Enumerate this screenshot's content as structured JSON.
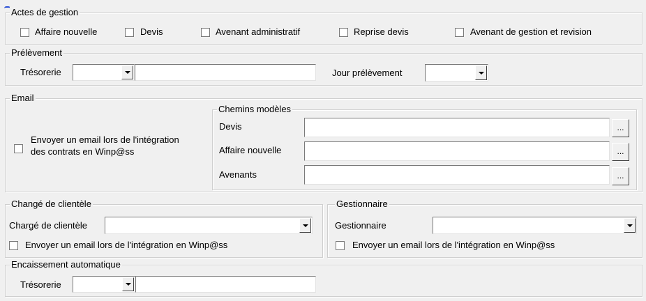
{
  "actes": {
    "legend": "Actes de gestion",
    "items": [
      {
        "label": "Affaire nouvelle"
      },
      {
        "label": "Devis"
      },
      {
        "label": "Avenant administratif"
      },
      {
        "label": "Reprise devis"
      },
      {
        "label": "Avenant de gestion et revision"
      }
    ]
  },
  "prelevement": {
    "legend": "Prélèvement",
    "tresorerie_label": "Trésorerie",
    "jour_label": "Jour prélèvement"
  },
  "email": {
    "legend": "Email",
    "checkbox_line1": "Envoyer un email lors de l'intégration",
    "checkbox_line2": "des contrats en Winp@ss",
    "chemins": {
      "legend": "Chemins modèles",
      "rows": [
        {
          "label": "Devis",
          "button": "..."
        },
        {
          "label": "Affaire nouvelle",
          "button": "..."
        },
        {
          "label": "Avenants",
          "button": "..."
        }
      ]
    }
  },
  "charge": {
    "legend": "Changé de clientèle",
    "label": "Chargé de clientèle",
    "checkbox": "Envoyer un email lors de l'intégration en Winp@ss"
  },
  "gestionnaire": {
    "legend": "Gestionnaire",
    "label": "Gestionnaire",
    "checkbox": "Envoyer un email lors de l'intégration en Winp@ss"
  },
  "encaissement": {
    "legend": "Encaissement automatique",
    "tresorerie_label": "Trésorerie"
  }
}
